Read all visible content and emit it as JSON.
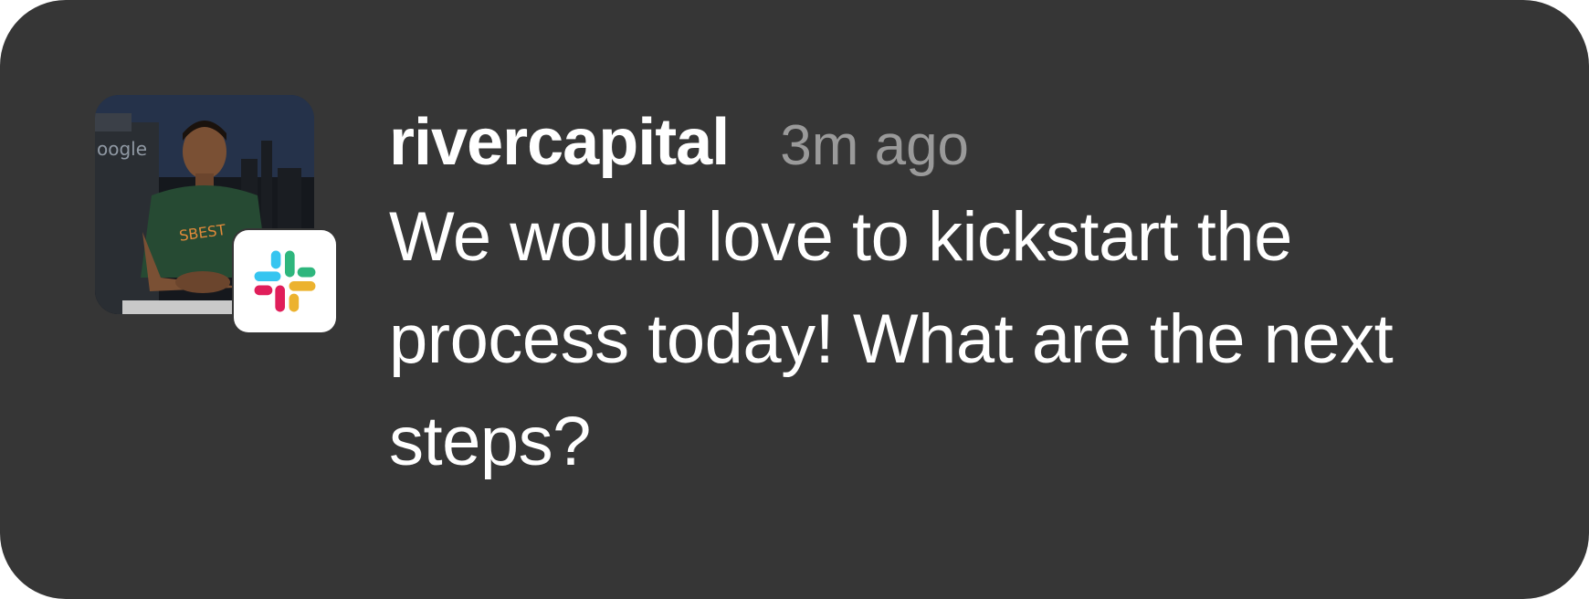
{
  "notification": {
    "app_icon": "slack-icon",
    "avatar_icon": "user-photo",
    "username": "rivercapital",
    "timestamp": "3m ago",
    "message": "We would love to kickstart the process today! What are the next steps?"
  },
  "colors": {
    "card_background": "#363636",
    "username": "#ffffff",
    "timestamp": "#9a9a9a",
    "message": "#ffffff",
    "slack_blue": "#36C5F0",
    "slack_green": "#2EB67D",
    "slack_yellow": "#ECB22E",
    "slack_red": "#E01E5A"
  }
}
